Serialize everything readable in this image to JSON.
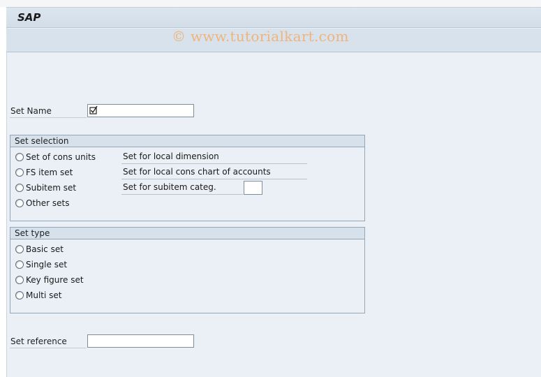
{
  "window": {
    "title": "SAP",
    "watermark": "© www.tutorialkart.com"
  },
  "set_name": {
    "label": "Set Name",
    "value": "",
    "icon": "required-check-icon"
  },
  "set_selection": {
    "title": "Set selection",
    "options": [
      {
        "label": "Set of cons units",
        "description": "Set for local dimension"
      },
      {
        "label": "FS item set",
        "description": "Set for local cons chart of accounts"
      },
      {
        "label": "Subitem set",
        "description": "Set for subitem categ."
      },
      {
        "label": "Other sets",
        "description": ""
      }
    ],
    "subitem_categ_value": ""
  },
  "set_type": {
    "title": "Set type",
    "options": [
      {
        "label": "Basic set"
      },
      {
        "label": "Single set"
      },
      {
        "label": "Key figure set"
      },
      {
        "label": "Multi set"
      }
    ]
  },
  "set_reference": {
    "label": "Set reference",
    "value": ""
  }
}
